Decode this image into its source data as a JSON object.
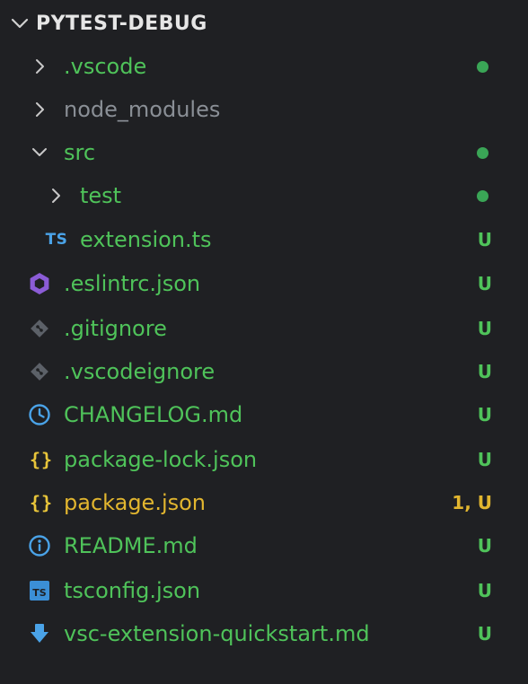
{
  "explorer": {
    "title": "PYTEST-DEBUG",
    "items": [
      {
        "name": ".vscode",
        "type": "folder",
        "expanded": false,
        "depth": 0,
        "status": "dot",
        "color": "#4fc35a"
      },
      {
        "name": "node_modules",
        "type": "folder",
        "expanded": false,
        "depth": 0,
        "status": "",
        "color": "#8a8f96"
      },
      {
        "name": "src",
        "type": "folder",
        "expanded": true,
        "depth": 0,
        "status": "dot",
        "color": "#4fc35a"
      },
      {
        "name": "test",
        "type": "folder",
        "expanded": false,
        "depth": 1,
        "status": "dot",
        "color": "#4fc35a"
      },
      {
        "name": "extension.ts",
        "type": "file",
        "icon": "typescript-icon",
        "icon_text": "TS",
        "depth": 1,
        "status": "U",
        "color": "#4fc35a"
      },
      {
        "name": ".eslintrc.json",
        "type": "file",
        "icon": "eslint-icon",
        "depth": 0,
        "status": "U",
        "color": "#4fc35a"
      },
      {
        "name": ".gitignore",
        "type": "file",
        "icon": "git-icon",
        "depth": 0,
        "status": "U",
        "color": "#4fc35a"
      },
      {
        "name": ".vscodeignore",
        "type": "file",
        "icon": "git-icon",
        "depth": 0,
        "status": "U",
        "color": "#4fc35a"
      },
      {
        "name": "CHANGELOG.md",
        "type": "file",
        "icon": "clock-icon",
        "depth": 0,
        "status": "U",
        "color": "#4fc35a"
      },
      {
        "name": "package-lock.json",
        "type": "file",
        "icon": "json-braces-icon",
        "icon_text": "{}",
        "depth": 0,
        "status": "U",
        "color": "#4fc35a"
      },
      {
        "name": "package.json",
        "type": "file",
        "icon": "json-braces-icon",
        "icon_text": "{}",
        "depth": 0,
        "status": "1, U",
        "color": "#e2b62f"
      },
      {
        "name": "README.md",
        "type": "file",
        "icon": "info-icon",
        "depth": 0,
        "status": "U",
        "color": "#4fc35a"
      },
      {
        "name": "tsconfig.json",
        "type": "file",
        "icon": "tsconfig-icon",
        "icon_text": "TS",
        "depth": 0,
        "status": "U",
        "color": "#4fc35a"
      },
      {
        "name": "vsc-extension-quickstart.md",
        "type": "file",
        "icon": "download-arrow-icon",
        "depth": 0,
        "status": "U",
        "color": "#4fc35a"
      }
    ]
  },
  "colors": {
    "background": "#1f2023",
    "untracked_green": "#4fc35a",
    "ignored_gray": "#8a8f96",
    "warning_yellow": "#e2b62f",
    "modified_dot": "#3aa556"
  }
}
